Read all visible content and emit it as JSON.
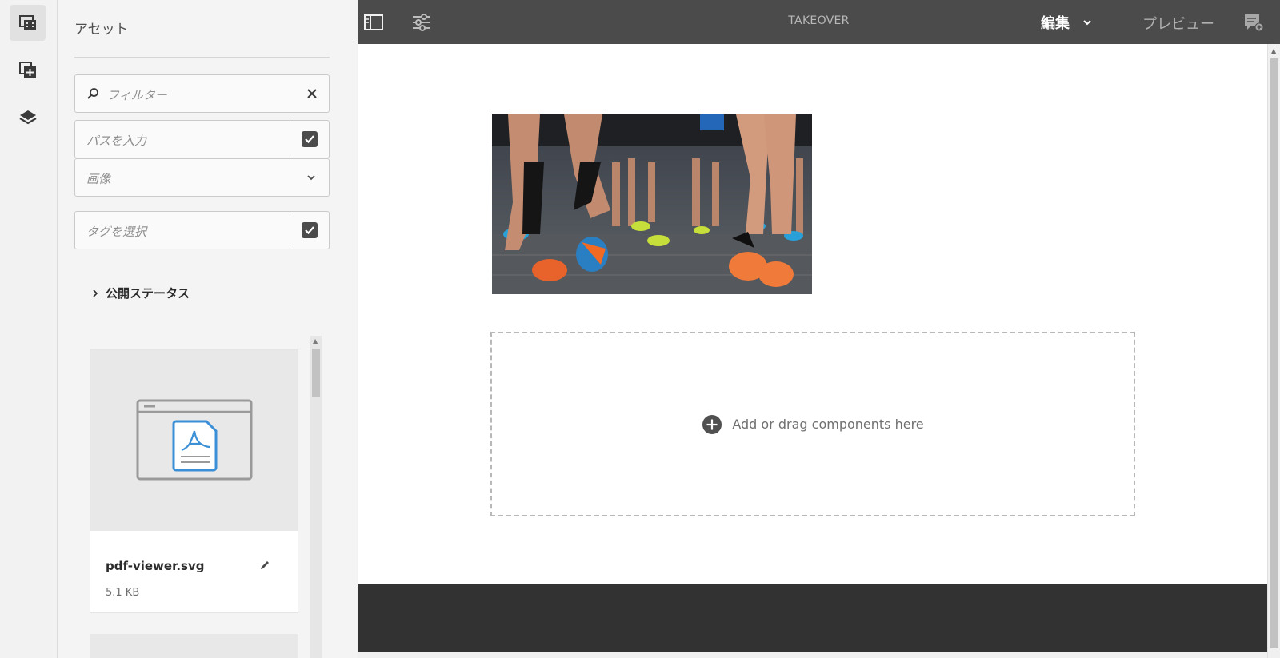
{
  "rail": {
    "items": [
      "assets-icon",
      "components-icon",
      "layers-icon"
    ]
  },
  "panel": {
    "title": "アセット",
    "filter_placeholder": "フィルター",
    "path_placeholder": "パスを入力",
    "type_select": "画像",
    "tags_placeholder": "タグを選択",
    "publish_status": "公開ステータス"
  },
  "assets": [
    {
      "name": "pdf-viewer.svg",
      "size": "5.1 KB"
    }
  ],
  "toolbar": {
    "title": "TAKEOVER",
    "mode": "編集",
    "preview": "プレビュー"
  },
  "canvas": {
    "dropzone_label": "Add or drag components here"
  },
  "colors": {
    "toolbar_bg": "#4b4b4b",
    "footer_bg": "#323232",
    "accent_blue": "#3b8fd6"
  }
}
